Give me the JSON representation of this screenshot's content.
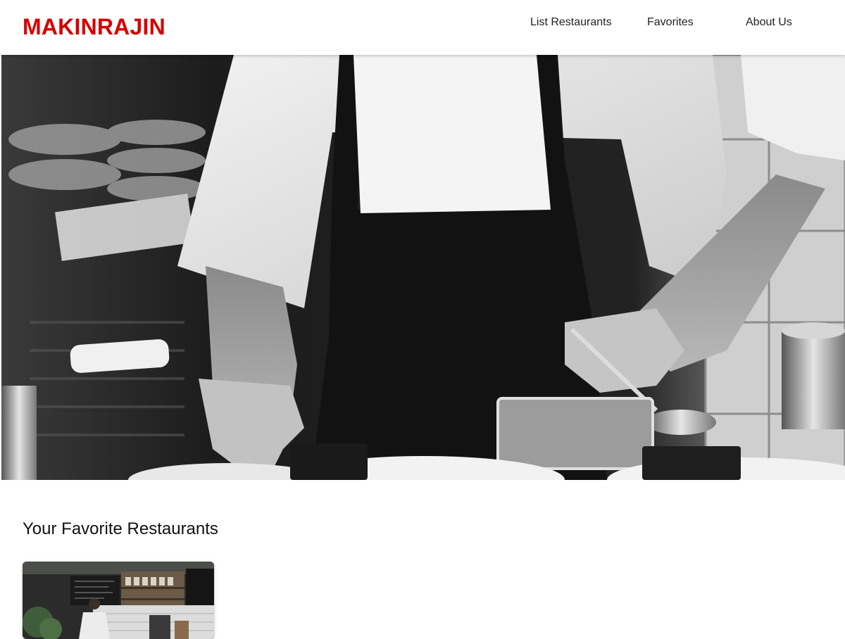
{
  "brand": {
    "name": "MAKINRAJIN",
    "color": "#d50000"
  },
  "nav": {
    "items": [
      {
        "label": "List Restaurants"
      },
      {
        "label": "Favorites"
      },
      {
        "label": "About Us"
      }
    ]
  },
  "hero": {
    "image": "chef-plating-in-kitchen-black-and-white-photo"
  },
  "favorites": {
    "title": "Your Favorite Restaurants",
    "cards": [
      {
        "image": "restaurant-interior-photo"
      }
    ]
  }
}
